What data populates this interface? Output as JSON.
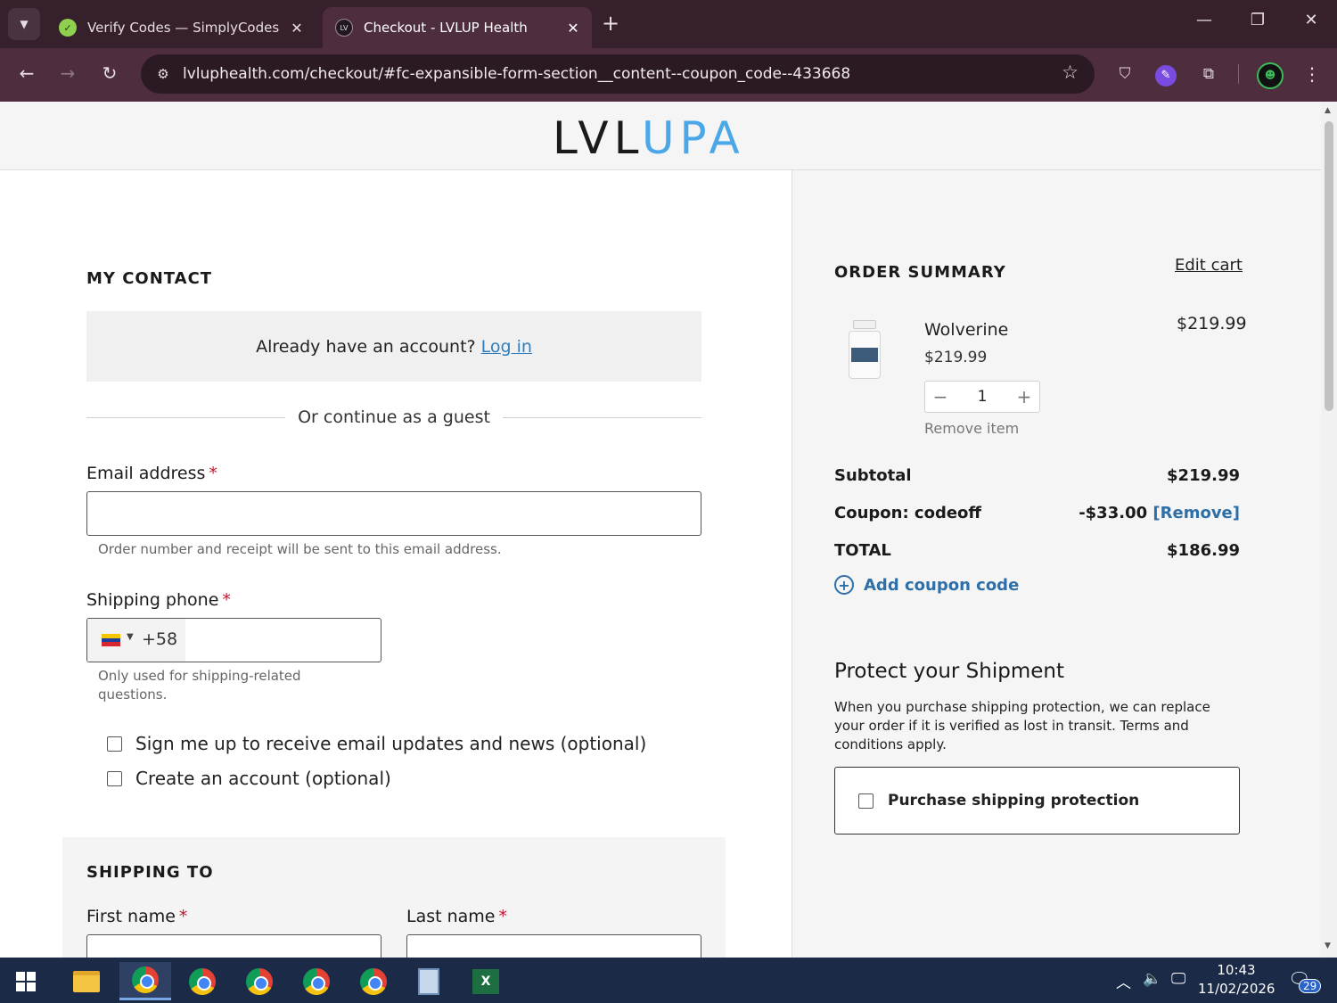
{
  "browser": {
    "tabs": [
      {
        "title": "Verify Codes — SimplyCodes",
        "active": false
      },
      {
        "title": "Checkout - LVLUP Health",
        "active": true
      }
    ],
    "url": "lvluphealth.com/checkout/#fc-expansible-form-section__content--coupon_code--433668"
  },
  "site": {
    "logo_dark": "LVL",
    "logo_blue": "UP",
    "logo_dark2": "A"
  },
  "contact": {
    "title": "MY CONTACT",
    "login_prompt": "Already have an account?",
    "login_link": "Log in",
    "guest_divider": "Or continue as a guest",
    "email_label": "Email address",
    "email_value": "",
    "email_hint": "Order number and receipt will be sent to this email address.",
    "phone_label": "Shipping phone",
    "phone_code": "+58",
    "phone_value": "",
    "phone_hint_1": "Only used for shipping-related",
    "phone_hint_2": "questions.",
    "newsletter_label": "Sign me up to receive email updates and news (optional)",
    "create_account_label": "Create an account (optional)",
    "required_mark": "*"
  },
  "shipping": {
    "title": "SHIPPING TO",
    "first_name_label": "First name",
    "last_name_label": "Last name"
  },
  "summary": {
    "title": "ORDER SUMMARY",
    "edit_cart": "Edit cart",
    "item": {
      "name": "Wolverine",
      "unit_price": "$219.99",
      "line_total": "$219.99",
      "quantity": "1",
      "remove": "Remove item"
    },
    "subtotal_label": "Subtotal",
    "subtotal_value": "$219.99",
    "coupon_label": "Coupon: codeoff",
    "coupon_value": "-$33.00",
    "coupon_remove": "[Remove]",
    "total_label": "TOTAL",
    "total_value": "$186.99",
    "add_coupon": "Add coupon code"
  },
  "protection": {
    "title": "Protect your Shipment",
    "text": "When you purchase shipping protection, we can replace your order if it is verified as lost in transit. Terms and conditions apply.",
    "checkbox_label": "Purchase shipping protection"
  },
  "taskbar": {
    "time": "10:43",
    "date": "11/02/2026",
    "notifications": "29"
  }
}
